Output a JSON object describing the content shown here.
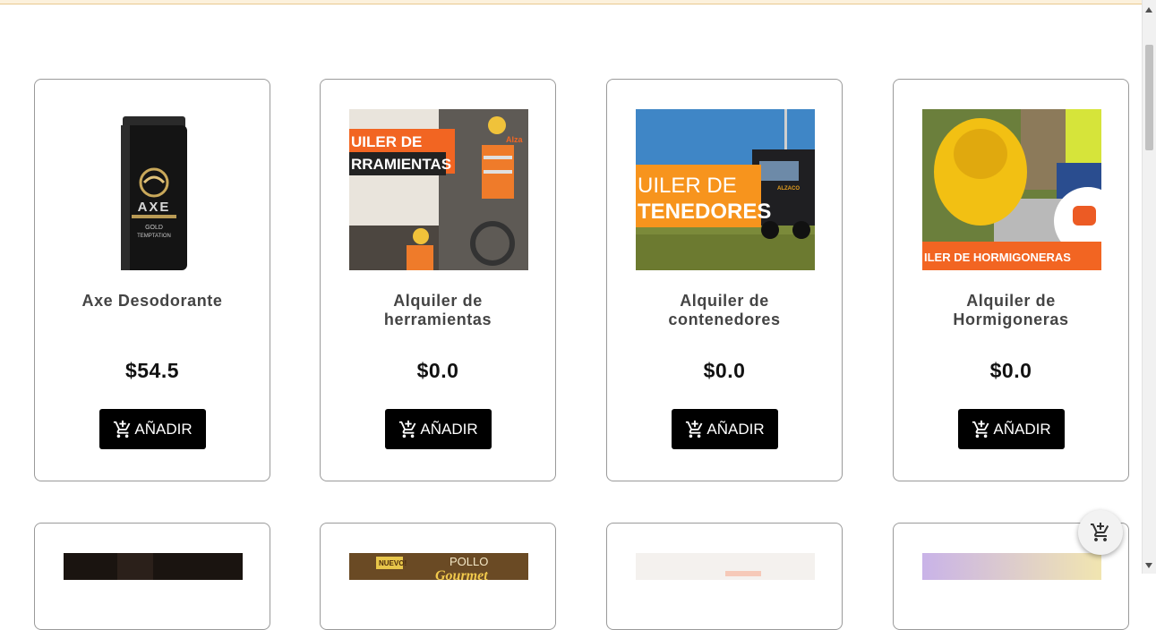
{
  "currency_symbol": "$",
  "add_button_label": "AÑADIR",
  "products": [
    {
      "name": "Axe Desodorante",
      "price": "$54.5",
      "image": "axe-deodorant",
      "image_text": [
        "AXE",
        "GOLD",
        "TEMPTATION"
      ]
    },
    {
      "name": "Alquiler de herramientas",
      "price": "$0.0",
      "image": "tool-rental-banner",
      "image_text": [
        "UILER DE",
        "RRAMIENTAS",
        "Alza"
      ]
    },
    {
      "name": "Alquiler de contenedores",
      "price": "$0.0",
      "image": "container-rental-banner",
      "image_text": [
        "UILER DE",
        "TENEDORES",
        "ALZACO"
      ]
    },
    {
      "name": "Alquiler de Hormigoneras",
      "price": "$0.0",
      "image": "concrete-mixer-banner",
      "image_text": [
        "ILER DE HORMIGONERAS"
      ]
    }
  ],
  "second_row_images": [
    {
      "image": "dark-photo"
    },
    {
      "image": "pollo-gourmet-banner",
      "image_text": [
        "NUEVO!",
        "POLLO",
        "Gourmet"
      ]
    },
    {
      "image": "light-banner"
    },
    {
      "image": "pastel-gradient"
    }
  ],
  "colors": {
    "button": "#000000",
    "card_border": "#9a9a9a",
    "accent_orange": "#f26522"
  }
}
